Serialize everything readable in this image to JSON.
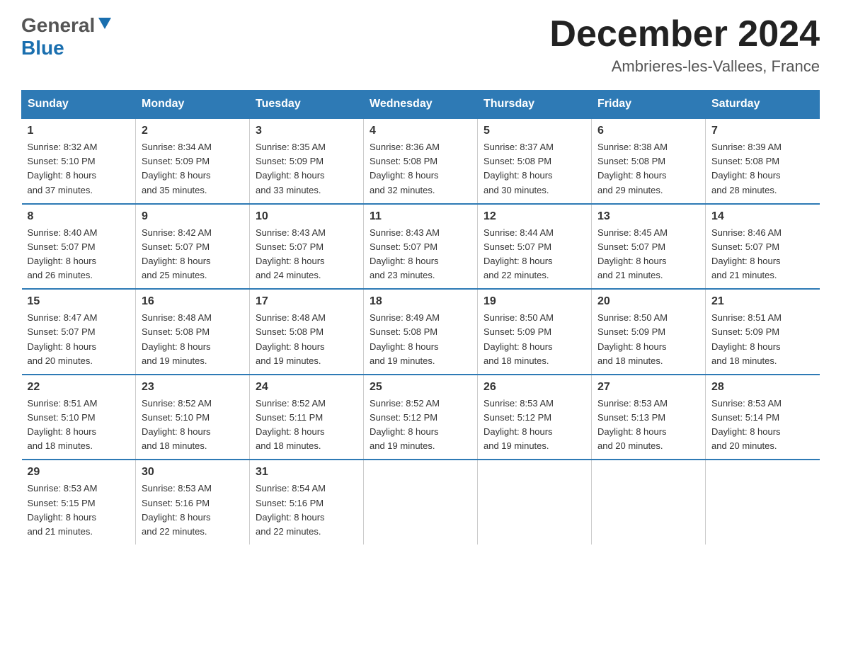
{
  "header": {
    "logo_general": "General",
    "logo_blue": "Blue",
    "month_title": "December 2024",
    "location": "Ambrieres-les-Vallees, France"
  },
  "days_of_week": [
    "Sunday",
    "Monday",
    "Tuesday",
    "Wednesday",
    "Thursday",
    "Friday",
    "Saturday"
  ],
  "weeks": [
    [
      {
        "day": "1",
        "sunrise": "8:32 AM",
        "sunset": "5:10 PM",
        "daylight": "8 hours and 37 minutes."
      },
      {
        "day": "2",
        "sunrise": "8:34 AM",
        "sunset": "5:09 PM",
        "daylight": "8 hours and 35 minutes."
      },
      {
        "day": "3",
        "sunrise": "8:35 AM",
        "sunset": "5:09 PM",
        "daylight": "8 hours and 33 minutes."
      },
      {
        "day": "4",
        "sunrise": "8:36 AM",
        "sunset": "5:08 PM",
        "daylight": "8 hours and 32 minutes."
      },
      {
        "day": "5",
        "sunrise": "8:37 AM",
        "sunset": "5:08 PM",
        "daylight": "8 hours and 30 minutes."
      },
      {
        "day": "6",
        "sunrise": "8:38 AM",
        "sunset": "5:08 PM",
        "daylight": "8 hours and 29 minutes."
      },
      {
        "day": "7",
        "sunrise": "8:39 AM",
        "sunset": "5:08 PM",
        "daylight": "8 hours and 28 minutes."
      }
    ],
    [
      {
        "day": "8",
        "sunrise": "8:40 AM",
        "sunset": "5:07 PM",
        "daylight": "8 hours and 26 minutes."
      },
      {
        "day": "9",
        "sunrise": "8:42 AM",
        "sunset": "5:07 PM",
        "daylight": "8 hours and 25 minutes."
      },
      {
        "day": "10",
        "sunrise": "8:43 AM",
        "sunset": "5:07 PM",
        "daylight": "8 hours and 24 minutes."
      },
      {
        "day": "11",
        "sunrise": "8:43 AM",
        "sunset": "5:07 PM",
        "daylight": "8 hours and 23 minutes."
      },
      {
        "day": "12",
        "sunrise": "8:44 AM",
        "sunset": "5:07 PM",
        "daylight": "8 hours and 22 minutes."
      },
      {
        "day": "13",
        "sunrise": "8:45 AM",
        "sunset": "5:07 PM",
        "daylight": "8 hours and 21 minutes."
      },
      {
        "day": "14",
        "sunrise": "8:46 AM",
        "sunset": "5:07 PM",
        "daylight": "8 hours and 21 minutes."
      }
    ],
    [
      {
        "day": "15",
        "sunrise": "8:47 AM",
        "sunset": "5:07 PM",
        "daylight": "8 hours and 20 minutes."
      },
      {
        "day": "16",
        "sunrise": "8:48 AM",
        "sunset": "5:08 PM",
        "daylight": "8 hours and 19 minutes."
      },
      {
        "day": "17",
        "sunrise": "8:48 AM",
        "sunset": "5:08 PM",
        "daylight": "8 hours and 19 minutes."
      },
      {
        "day": "18",
        "sunrise": "8:49 AM",
        "sunset": "5:08 PM",
        "daylight": "8 hours and 19 minutes."
      },
      {
        "day": "19",
        "sunrise": "8:50 AM",
        "sunset": "5:09 PM",
        "daylight": "8 hours and 18 minutes."
      },
      {
        "day": "20",
        "sunrise": "8:50 AM",
        "sunset": "5:09 PM",
        "daylight": "8 hours and 18 minutes."
      },
      {
        "day": "21",
        "sunrise": "8:51 AM",
        "sunset": "5:09 PM",
        "daylight": "8 hours and 18 minutes."
      }
    ],
    [
      {
        "day": "22",
        "sunrise": "8:51 AM",
        "sunset": "5:10 PM",
        "daylight": "8 hours and 18 minutes."
      },
      {
        "day": "23",
        "sunrise": "8:52 AM",
        "sunset": "5:10 PM",
        "daylight": "8 hours and 18 minutes."
      },
      {
        "day": "24",
        "sunrise": "8:52 AM",
        "sunset": "5:11 PM",
        "daylight": "8 hours and 18 minutes."
      },
      {
        "day": "25",
        "sunrise": "8:52 AM",
        "sunset": "5:12 PM",
        "daylight": "8 hours and 19 minutes."
      },
      {
        "day": "26",
        "sunrise": "8:53 AM",
        "sunset": "5:12 PM",
        "daylight": "8 hours and 19 minutes."
      },
      {
        "day": "27",
        "sunrise": "8:53 AM",
        "sunset": "5:13 PM",
        "daylight": "8 hours and 20 minutes."
      },
      {
        "day": "28",
        "sunrise": "8:53 AM",
        "sunset": "5:14 PM",
        "daylight": "8 hours and 20 minutes."
      }
    ],
    [
      {
        "day": "29",
        "sunrise": "8:53 AM",
        "sunset": "5:15 PM",
        "daylight": "8 hours and 21 minutes."
      },
      {
        "day": "30",
        "sunrise": "8:53 AM",
        "sunset": "5:16 PM",
        "daylight": "8 hours and 22 minutes."
      },
      {
        "day": "31",
        "sunrise": "8:54 AM",
        "sunset": "5:16 PM",
        "daylight": "8 hours and 22 minutes."
      },
      null,
      null,
      null,
      null
    ]
  ],
  "labels": {
    "sunrise": "Sunrise:",
    "sunset": "Sunset:",
    "daylight": "Daylight:"
  }
}
